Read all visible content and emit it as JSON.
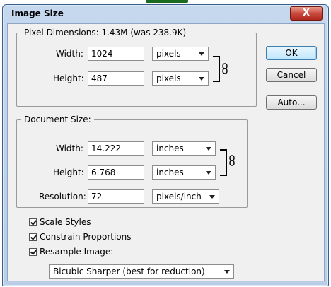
{
  "dialog": {
    "title": "Image Size",
    "close_glyph": "X"
  },
  "pixel_dimensions": {
    "legend": "Pixel Dimensions:  1.43M (was 238.9K)",
    "width_label": "Width:",
    "width_value": "1024",
    "width_unit": "pixels",
    "height_label": "Height:",
    "height_value": "487",
    "height_unit": "pixels"
  },
  "document_size": {
    "legend": "Document Size:",
    "width_label": "Width:",
    "width_value": "14.222",
    "width_unit": "inches",
    "height_label": "Height:",
    "height_value": "6.768",
    "height_unit": "inches",
    "resolution_label": "Resolution:",
    "resolution_value": "72",
    "resolution_unit": "pixels/inch"
  },
  "options": {
    "scale_styles": {
      "label": "Scale Styles",
      "checked": true
    },
    "constrain_proportions": {
      "label": "Constrain Proportions",
      "checked": true
    },
    "resample_image": {
      "label": "Resample Image:",
      "checked": true
    },
    "resample_method": "Bicubic Sharper (best for reduction)"
  },
  "buttons": {
    "ok": "OK",
    "cancel": "Cancel",
    "auto": "Auto..."
  },
  "colors": {
    "title_bar": "#c6d8ee",
    "close_button": "#c8453a",
    "client_bg": "#f0f0f0",
    "default_button": "#bee6fd"
  }
}
